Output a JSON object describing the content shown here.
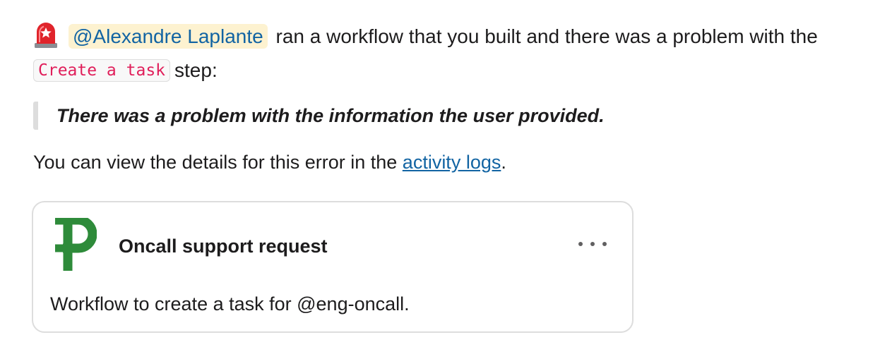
{
  "message": {
    "mention": "@Alexandre Laplante",
    "text_after_mention": " ran a workflow that you built and there was a problem with the",
    "step_code": "Create a task",
    "text_after_code": "step:",
    "quote": "There was a problem with the information the user provided.",
    "details_prefix": "You can view the details for this error in the ",
    "details_link": "activity logs",
    "details_suffix": "."
  },
  "card": {
    "title": "Oncall support request",
    "description": "Workflow to create a task for @eng-oncall.",
    "logo_icon": "workflow-p-logo-icon",
    "menu_icon": "more-options-icon"
  },
  "colors": {
    "mention_text": "#1264a3",
    "mention_bg": "#fdf2d0",
    "code_text": "#e01e5a",
    "link": "#1264a3",
    "logo_green": "#2e8b3a"
  }
}
